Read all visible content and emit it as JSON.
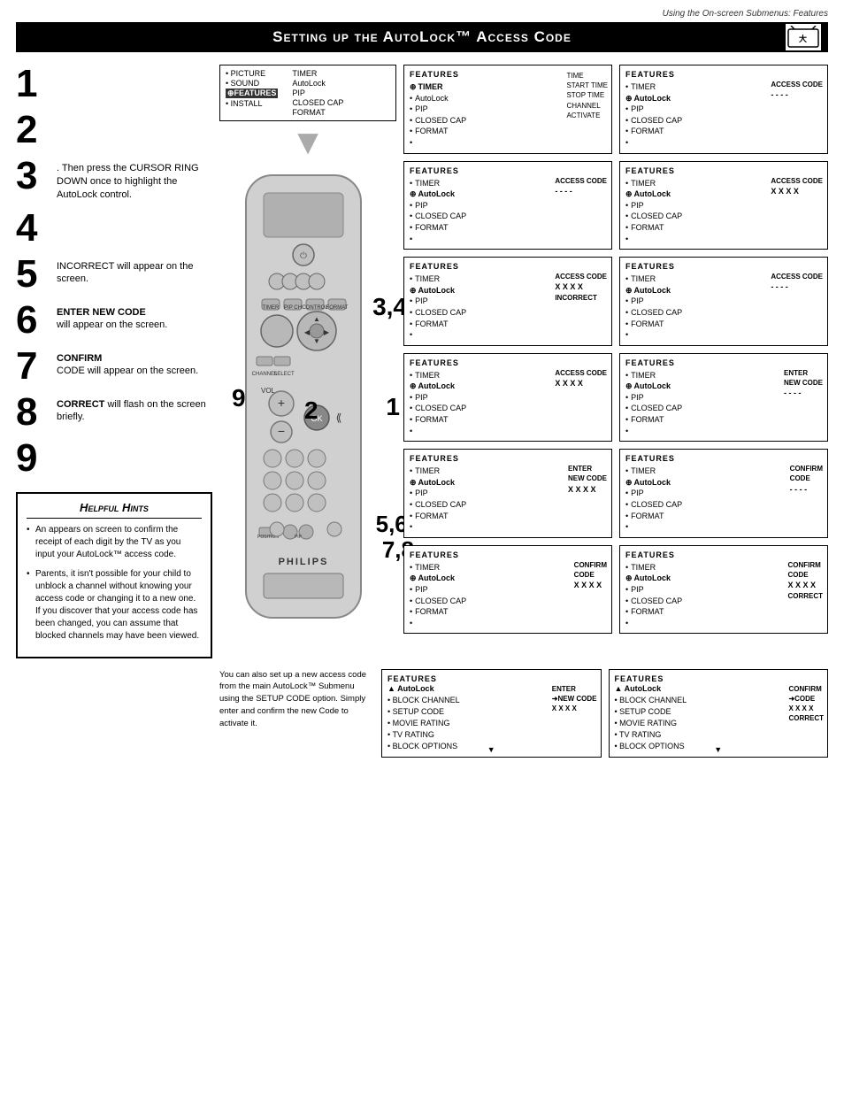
{
  "header": {
    "top_right": "Using the On-screen Submenus: Features",
    "title": "Setting up the AutoLock™ Access Code"
  },
  "steps": [
    {
      "num": "1",
      "text": ""
    },
    {
      "num": "2",
      "text": ""
    },
    {
      "num": "3",
      "text": ". Then press the CURSOR RING DOWN once to highlight the AutoLock control."
    },
    {
      "num": "4",
      "text": ""
    },
    {
      "num": "5",
      "text": "INCORRECT will appear on the screen."
    },
    {
      "num": "6",
      "text": "ENTER NEW CODE will appear on the screen."
    },
    {
      "num": "7",
      "text": "CONFIRM CODE will appear on the screen."
    },
    {
      "num": "8",
      "text": "CORRECT will flash on the screen briefly."
    },
    {
      "num": "9",
      "text": ""
    }
  ],
  "hints": {
    "title": "Helpful Hints",
    "items": [
      "An    appears on screen to confirm the receipt of each digit by the TV as you input your AutoLock™ access code.",
      "Parents, it isn't possible for your child to unblock a channel without knowing your access code or changing it to a new one. If you discover that your access code has been changed, you can assume that blocked channels may have been viewed."
    ]
  },
  "main_menu": {
    "items_left": [
      "• PICTURE",
      "• SOUND",
      "FEATURES",
      "• INSTALL"
    ],
    "items_right": [
      "TIMER",
      "AutoLock",
      "PIP",
      "CLOSED CAP",
      "FORMAT"
    ]
  },
  "screens": {
    "col1": [
      {
        "title": "FEATURES",
        "items": [
          "TIMER",
          "AutoLock",
          "• PIP",
          "• CLOSED CAP",
          "• FORMAT",
          "•"
        ],
        "highlighted": 0,
        "right_label": "TIME\nSTART TIME\nSTOP TIME\nCHANNEL\nACTIVATE",
        "right_title": ""
      },
      {
        "title": "FEATURES",
        "items": [
          "• TIMER",
          "AutoLock",
          "• PIP",
          "• CLOSED CAP",
          "• FORMAT",
          "•"
        ],
        "highlighted": 1,
        "right_label": "- - - -",
        "right_title": "ACCESS CODE"
      },
      {
        "title": "FEATURES",
        "items": [
          "• TIMER",
          "AutoLock",
          "• PIP",
          "• CLOSED CAP",
          "• FORMAT",
          "•"
        ],
        "highlighted": 1,
        "right_label": "X X X X\nINCORRECT",
        "right_title": "ACCESS CODE"
      },
      {
        "title": "FEATURES",
        "items": [
          "• TIMER",
          "AutoLock",
          "• PIP",
          "• CLOSED CAP",
          "• FORMAT",
          "•"
        ],
        "highlighted": 1,
        "right_label": "X X X X",
        "right_title": "ACCESS CODE"
      },
      {
        "title": "FEATURES",
        "items": [
          "• TIMER",
          "AutoLock",
          "• PIP",
          "• CLOSED CAP",
          "• FORMAT",
          "•"
        ],
        "highlighted": 1,
        "right_label": "X X X X",
        "right_title": "ENTER\nNEW CODE"
      },
      {
        "title": "FEATURES",
        "items": [
          "• TIMER",
          "AutoLock",
          "• PIP",
          "• CLOSED CAP",
          "• FORMAT",
          "•"
        ],
        "highlighted": 1,
        "right_label": "X X X X",
        "right_title": "CONFIRM\nCODE"
      }
    ],
    "col2": [
      {
        "title": "FEATURES",
        "items": [
          "• TIMER",
          "AutoLock",
          "• PIP",
          "• CLOSED CAP",
          "• FORMAT",
          "•"
        ],
        "highlighted": 1,
        "right_label": "- - - -",
        "right_title": "ACCESS CODE"
      },
      {
        "title": "FEATURES",
        "items": [
          "• TIMER",
          "AutoLock",
          "• PIP",
          "• CLOSED CAP",
          "• FORMAT",
          "•"
        ],
        "highlighted": 1,
        "right_label": "X X X X",
        "right_title": "ACCESS CODE"
      },
      {
        "title": "FEATURES",
        "items": [
          "• TIMER",
          "AutoLock",
          "• PIP",
          "• CLOSED CAP",
          "• FORMAT",
          "•"
        ],
        "highlighted": 1,
        "right_label": "- - - -",
        "right_title": "ACCESS CODE"
      },
      {
        "title": "FEATURES",
        "items": [
          "• TIMER",
          "AutoLock",
          "• PIP",
          "• CLOSED CAP",
          "• FORMAT",
          "•"
        ],
        "highlighted": 1,
        "right_label": "- - - -",
        "right_title": "ENTER\nNEW CODE"
      },
      {
        "title": "FEATURES",
        "items": [
          "• TIMER",
          "AutoLock",
          "• PIP",
          "• CLOSED CAP",
          "• FORMAT",
          "•"
        ],
        "highlighted": 1,
        "right_label": "- - - -",
        "right_title": "CONFIRM\nCODE"
      },
      {
        "title": "FEATURES",
        "items": [
          "• TIMER",
          "AutoLock",
          "• PIP",
          "• CLOSED CAP",
          "• FORMAT",
          "•"
        ],
        "highlighted": 1,
        "right_label": "X X X X\nCORRECT",
        "right_title": "CONFIRM\nCODE"
      }
    ]
  },
  "bottom_text": "You can also set up a new access code from the main AutoLock™ Submenu using the SETUP CODE option. Simply enter and confirm the new Code to activate it.",
  "bottom_screens": {
    "left": {
      "title": "FEATURES",
      "subtitle": "AutoLock",
      "items": [
        "• BLOCK CHANNEL",
        "• SETUP CODE",
        "• MOVIE RATING",
        "• TV RATING",
        "• BLOCK OPTIONS"
      ],
      "right_title": "ENTER",
      "right_label": "➜NEW CODE\nX X X X"
    },
    "right": {
      "title": "FEATURES",
      "subtitle": "AutoLock",
      "items": [
        "• BLOCK CHANNEL",
        "• SETUP CODE",
        "• MOVIE RATING",
        "• TV RATING",
        "• BLOCK OPTIONS"
      ],
      "right_title": "CONFIRM",
      "right_label": "➜CODE\nX X X X\nCORRECT"
    }
  },
  "big_numbers": {
    "group1": "3,4",
    "group2_a": "9",
    "group2_b": "2",
    "group2_c": "1",
    "group3": "5,6,\n7,8"
  }
}
